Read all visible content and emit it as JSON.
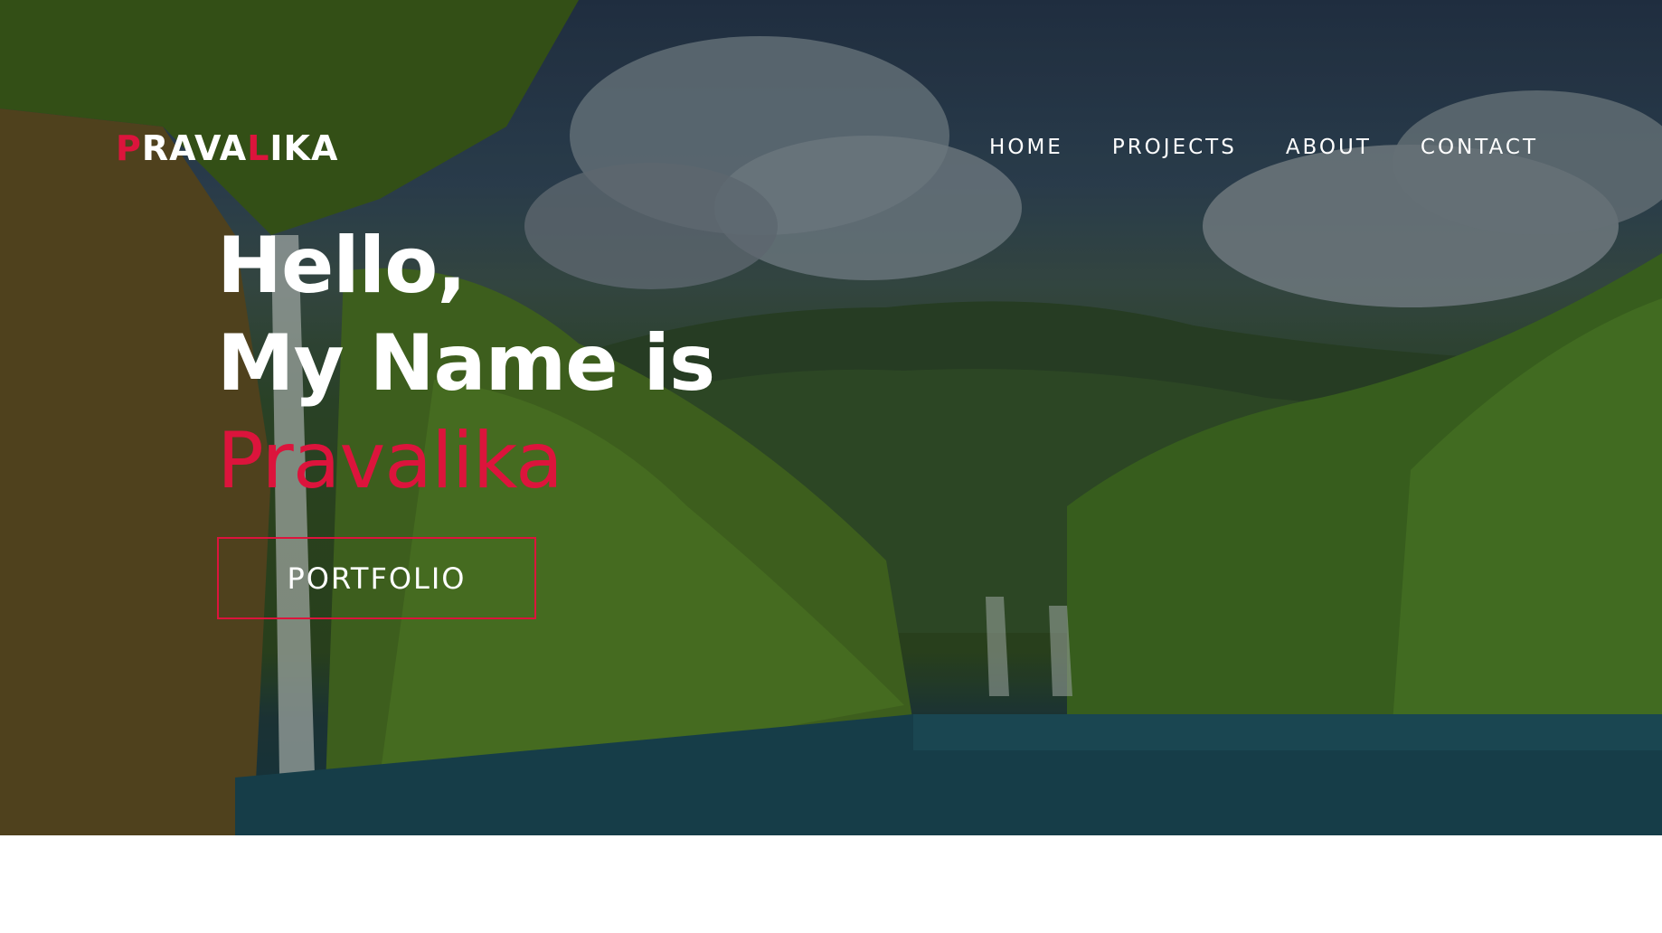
{
  "brand": {
    "logo_first": "P",
    "logo_mid": "RAVA",
    "logo_accent": "L",
    "logo_last": "IKA",
    "accent_color": "#dc143c"
  },
  "nav": {
    "items": [
      {
        "label": "HOME"
      },
      {
        "label": "PROJECTS"
      },
      {
        "label": "ABOUT"
      },
      {
        "label": "CONTACT"
      }
    ]
  },
  "hero": {
    "line1": "Hello,",
    "line2": "My Name is",
    "name": "Pravalika",
    "cta_label": "PORTFOLIO",
    "background": "forest-waterfall-lake-image"
  }
}
